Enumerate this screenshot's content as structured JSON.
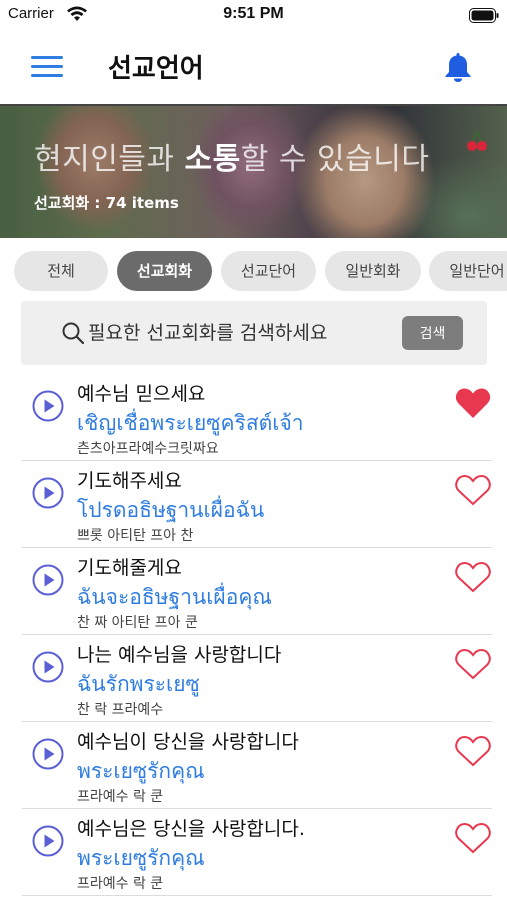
{
  "status_bar": {
    "carrier": "Carrier",
    "time": "9:51 PM",
    "wifi_icon": "wifi-icon",
    "battery_icon": "battery-icon"
  },
  "nav": {
    "title": "선교언어",
    "menu_icon": "hamburger-menu-icon",
    "bell_icon": "bell-icon"
  },
  "banner": {
    "headline_pre": "현지인들과 ",
    "headline_bold": "소통",
    "headline_post": "할 수 있습니다",
    "count_text": "선교회화 : 74 items"
  },
  "chips": [
    {
      "label": "전체",
      "active": false
    },
    {
      "label": "선교회화",
      "active": true
    },
    {
      "label": "선교단어",
      "active": false
    },
    {
      "label": "일반회화",
      "active": false
    },
    {
      "label": "일반단어",
      "active": false
    }
  ],
  "search": {
    "placeholder": "필요한 선교회화를 검색하세요",
    "button_label": "검색",
    "icon": "search-icon"
  },
  "items": [
    {
      "korean": "예수님 믿으세요",
      "thai": "เชิญเชื่อพระเยซูคริสต์เจ้า",
      "pronunciation": "츤츠아프라예수크릿짜요",
      "favorite": true
    },
    {
      "korean": "기도해주세요",
      "thai": "โปรดอธิษฐานเผื่อฉัน",
      "pronunciation": "쁘롯 아티탄 프아 찬",
      "favorite": false
    },
    {
      "korean": "기도해줄게요",
      "thai": "ฉันจะอธิษฐานเผื่อคุณ",
      "pronunciation": "찬 짜 아티탄 프아 쿤",
      "favorite": false
    },
    {
      "korean": "나는 예수님을 사랑합니다",
      "thai": "ฉันรักพระเยซู",
      "pronunciation": "찬 락 프라예수",
      "favorite": false
    },
    {
      "korean": "예수님이 당신을 사랑합니다",
      "thai": "พระเยซูรักคุณ",
      "pronunciation": "프라예수 락 쿤",
      "favorite": false
    },
    {
      "korean": "예수님은 당신을 사랑합니다.",
      "thai": "พระเยซูรักคุณ",
      "pronunciation": "프라예수 락 쿤",
      "favorite": false
    }
  ],
  "colors": {
    "accent": "#2f7de0",
    "heart_filled": "#e8384f",
    "play_icon": "#5b5fd6",
    "chip_active": "#6b6b6b"
  }
}
